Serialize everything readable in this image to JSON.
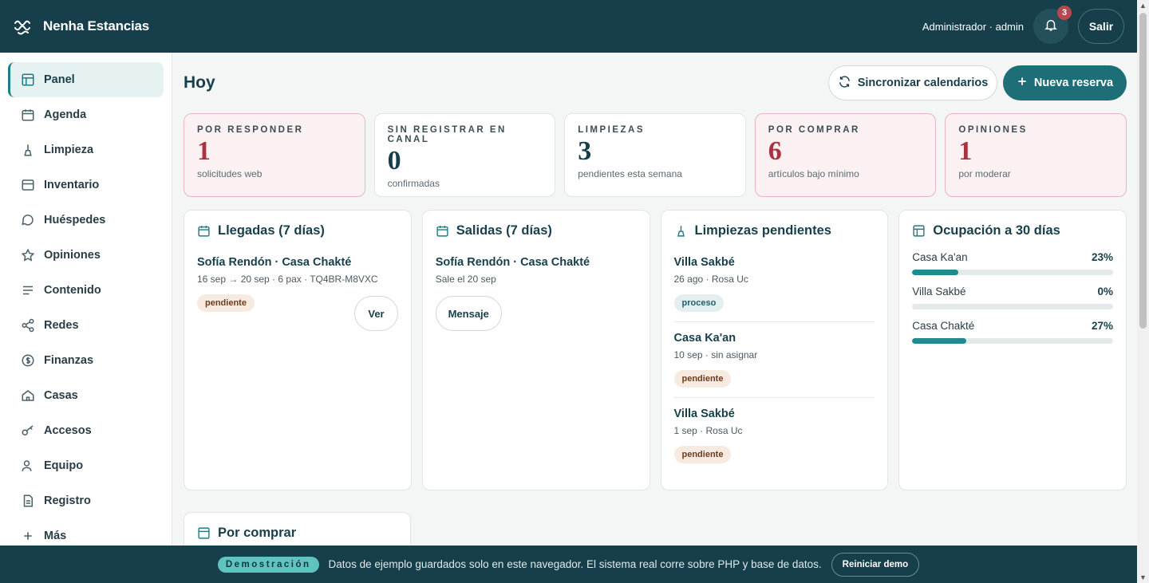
{
  "brand": {
    "name": "Nenha Estancias"
  },
  "header": {
    "user_label": "Administrador · admin",
    "notifications_count": "3",
    "logout_label": "Salir"
  },
  "sidebar": {
    "items": [
      {
        "label": "Panel",
        "icon": "dashboard-icon",
        "active": true
      },
      {
        "label": "Agenda",
        "icon": "calendar-icon"
      },
      {
        "label": "Limpieza",
        "icon": "broom-icon"
      },
      {
        "label": "Inventario",
        "icon": "box-icon"
      },
      {
        "label": "Huéspedes",
        "icon": "chat-icon"
      },
      {
        "label": "Opiniones",
        "icon": "star-icon"
      },
      {
        "label": "Contenido",
        "icon": "lines-icon"
      },
      {
        "label": "Redes",
        "icon": "share-icon"
      },
      {
        "label": "Finanzas",
        "icon": "dollar-icon"
      },
      {
        "label": "Casas",
        "icon": "home-icon"
      },
      {
        "label": "Accesos",
        "icon": "key-icon"
      },
      {
        "label": "Equipo",
        "icon": "users-icon"
      },
      {
        "label": "Registro",
        "icon": "document-icon"
      },
      {
        "label": "Más",
        "icon": "plus-icon"
      }
    ]
  },
  "main": {
    "title": "Hoy",
    "sync_label": "Sincronizar calendarios",
    "new_label": "Nueva reserva",
    "stats": [
      {
        "label": "Por responder",
        "value": "1",
        "sub": "solicitudes web",
        "alert": true
      },
      {
        "label": "Sin registrar en canal",
        "value": "0",
        "sub": "confirmadas",
        "alert": false
      },
      {
        "label": "Limpiezas",
        "value": "3",
        "sub": "pendientes esta semana",
        "alert": false
      },
      {
        "label": "Por comprar",
        "value": "6",
        "sub": "artículos bajo mínimo",
        "alert": true
      },
      {
        "label": "Opiniones",
        "value": "1",
        "sub": "por moderar",
        "alert": true
      }
    ],
    "arrivals": {
      "title": "Llegadas (7 días)",
      "entry_title": "Sofía Rendón · Casa Chakté",
      "entry_sub": "16 sep → 20 sep · 6 pax · TQ4BR-M8VXC",
      "badge": "pendiente",
      "button": "Ver"
    },
    "departures": {
      "title": "Salidas (7 días)",
      "entry_title": "Sofía Rendón · Casa Chakté",
      "entry_sub": "Sale el 20 sep",
      "button": "Mensaje"
    },
    "cleanings": {
      "title": "Limpiezas pendientes",
      "items": [
        {
          "title": "Villa Sakbé",
          "sub": "26 ago · Rosa Uc",
          "badge": "proceso"
        },
        {
          "title": "Casa Ka'an",
          "sub": "10 sep · sin asignar",
          "badge": "pendiente"
        },
        {
          "title": "Villa Sakbé",
          "sub": "1 sep · Rosa Uc",
          "badge": "pendiente"
        }
      ]
    },
    "occupancy": {
      "title": "Ocupación a 30 días",
      "rows": [
        {
          "name": "Casa Ka'an",
          "pct": "23%",
          "value": 0.23
        },
        {
          "name": "Villa Sakbé",
          "pct": "0%",
          "value": 0
        },
        {
          "name": "Casa Chakté",
          "pct": "27%",
          "value": 0.27
        }
      ]
    },
    "purchases": {
      "title": "Por comprar"
    }
  },
  "demo": {
    "chip": "Demostración",
    "text": "Datos de ejemplo guardados solo en este navegador. El sistema real corre sobre PHP y base de datos.",
    "button": "Reiniciar demo"
  },
  "colors": {
    "header_bg": "#173f4b",
    "accent": "#1e6e77",
    "alert_bg": "#fbf1f2",
    "alert_text": "#a8323e"
  }
}
